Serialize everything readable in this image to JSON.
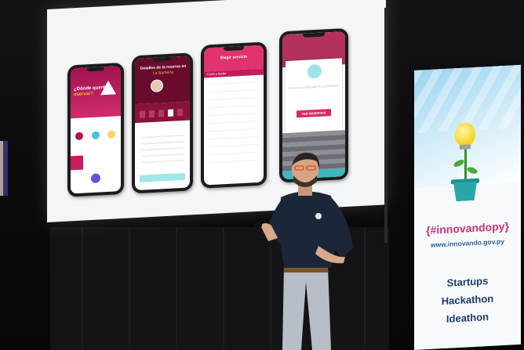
{
  "slide": {
    "phone1": {
      "title_line1": "¿Dónde querés",
      "title_line2": "eservar?"
    },
    "phone2": {
      "title": "Detalles de la reserva en",
      "subtitle": "La Barbería"
    },
    "phone3": {
      "title": "Elegir servicio",
      "section": "Corte y barba"
    },
    "phone4": {
      "modal_text": "Reserva confirmada en La Barbería",
      "cta": "VER RESERVAS"
    }
  },
  "banner": {
    "hashtag": "{#innovandopy}",
    "url": "www.innovando.gov.py",
    "words": [
      "Startups",
      "Hackathon",
      "Ideathon"
    ]
  },
  "colors": {
    "brand_magenta": "#c81d5f",
    "banner_hashtag": "#c7337a",
    "banner_text": "#1e3c6a",
    "teal": "#3bb9c0"
  }
}
